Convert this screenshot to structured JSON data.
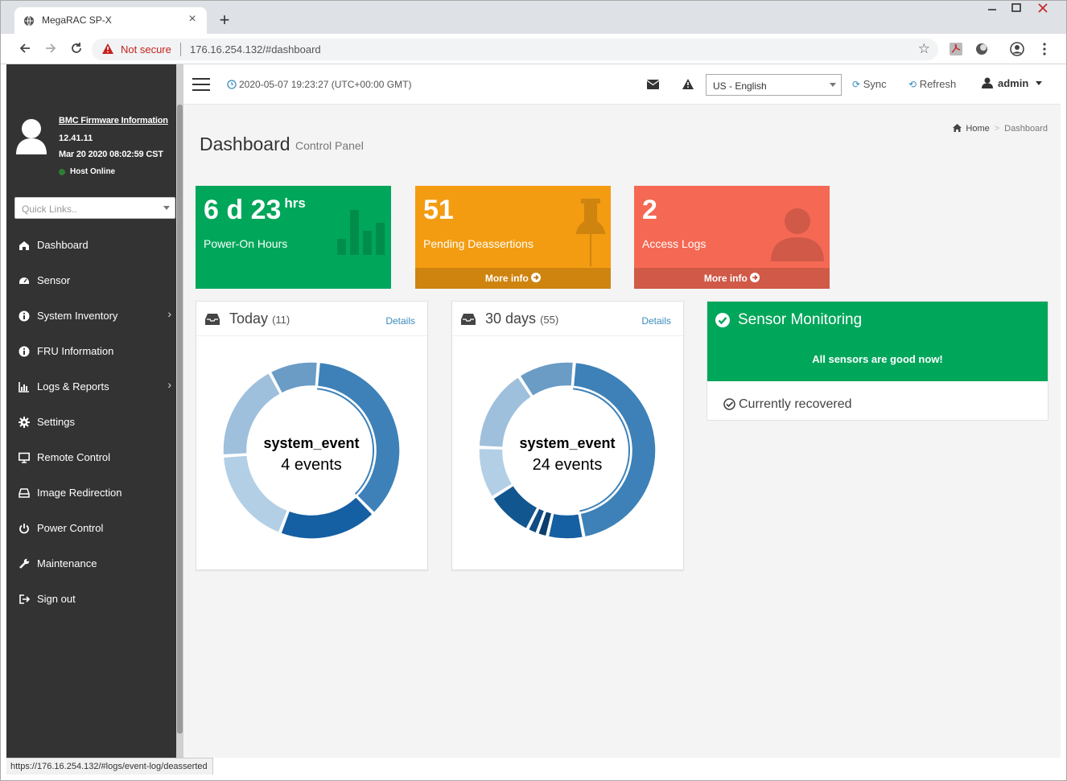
{
  "browser": {
    "tab_title": "MegaRAC SP-X",
    "tab_close": "×",
    "new_tab": "+",
    "not_secure": "Not secure",
    "url": "176.16.254.132/#dashboard",
    "status_url": "https://176.16.254.132/#logs/event-log/deasserted"
  },
  "sidebar": {
    "fw_title": "BMC Firmware Information",
    "fw_version": "12.41.11",
    "fw_date": "Mar 20 2020 08:02:59 CST",
    "host_status": "Host Online",
    "quicklinks_placeholder": "Quick Links..",
    "items": [
      {
        "label": "Dashboard",
        "icon": "dashboard-icon"
      },
      {
        "label": "Sensor",
        "icon": "sensor-icon"
      },
      {
        "label": "System Inventory",
        "icon": "info-icon",
        "arrow": "›"
      },
      {
        "label": "FRU Information",
        "icon": "info-icon"
      },
      {
        "label": "Logs & Reports",
        "icon": "bar-chart-icon",
        "arrow": "›"
      },
      {
        "label": "Settings",
        "icon": "gear-icon"
      },
      {
        "label": "Remote Control",
        "icon": "monitor-icon"
      },
      {
        "label": "Image Redirection",
        "icon": "drive-icon"
      },
      {
        "label": "Power Control",
        "icon": "power-icon"
      },
      {
        "label": "Maintenance",
        "icon": "wrench-icon"
      },
      {
        "label": "Sign out",
        "icon": "sign-out-icon"
      }
    ]
  },
  "header": {
    "datetime": "2020-05-07 19:23:27 (UTC+00:00 GMT)",
    "language": "US - English",
    "sync": "Sync",
    "refresh": "Refresh",
    "user": "admin"
  },
  "page": {
    "title": "Dashboard",
    "subtitle": "Control Panel",
    "breadcrumb_home": "Home",
    "breadcrumb_current": "Dashboard"
  },
  "boxes": {
    "power": {
      "value": "6 d 23",
      "unit": "hrs",
      "label": "Power-On Hours",
      "color": "#00a65a"
    },
    "pending": {
      "value": "51",
      "label": "Pending Deassertions",
      "more": "More info",
      "color": "#f39c12"
    },
    "access": {
      "value": "2",
      "label": "Access Logs",
      "more": "More info",
      "color": "#f56954"
    }
  },
  "panels": {
    "today": {
      "title": "Today",
      "count": "(11)",
      "details": "Details",
      "center_category": "system_event",
      "center_count": "4 events",
      "segments": [
        {
          "value": 4,
          "color": "#3d81b8"
        },
        {
          "value": 2,
          "color": "#155fa3"
        },
        {
          "value": 2,
          "color": "#b3cfe5"
        },
        {
          "value": 2,
          "color": "#9fc0dc"
        },
        {
          "value": 1,
          "color": "#6a9cc6"
        }
      ]
    },
    "days30": {
      "title": "30 days",
      "count": "(55)",
      "details": "Details",
      "center_category": "system_event",
      "center_count": "24 events",
      "segments": [
        {
          "value": 24,
          "color": "#3d81b8"
        },
        {
          "value": 3.5,
          "color": "#155fa3"
        },
        {
          "value": 1,
          "color": "#0b3d6e"
        },
        {
          "value": 1,
          "color": "#0f4c86"
        },
        {
          "value": 4.5,
          "color": "#12568f"
        },
        {
          "value": 5,
          "color": "#b3cfe5"
        },
        {
          "value": 8,
          "color": "#9fc0dc"
        },
        {
          "value": 5.5,
          "color": "#6a9cc6"
        }
      ]
    }
  },
  "sensor": {
    "title": "Sensor Monitoring",
    "message": "All sensors are good now!",
    "recovered": "Currently recovered"
  }
}
